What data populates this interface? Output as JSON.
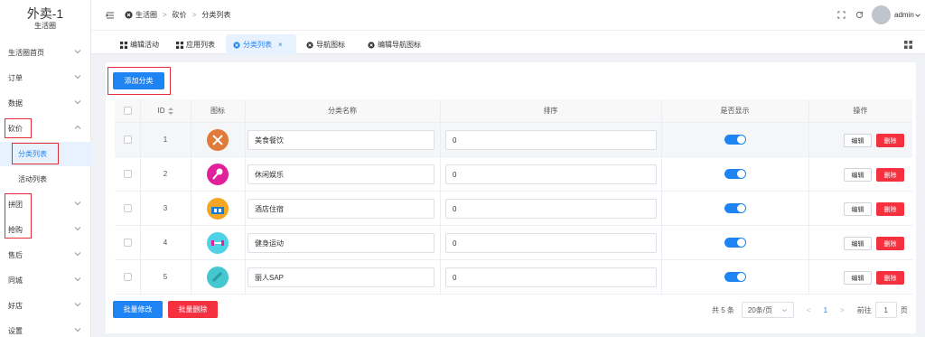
{
  "sidebar": {
    "app_title": "外卖-1",
    "app_subtitle": "生活圈",
    "items": [
      {
        "label": "生活圈首页",
        "expanded": false
      },
      {
        "label": "订单",
        "expanded": false
      },
      {
        "label": "数据",
        "expanded": false
      },
      {
        "label": "砍价",
        "expanded": true
      },
      {
        "label": "分类列表",
        "sub": true,
        "active": true
      },
      {
        "label": "活动列表",
        "sub": true
      },
      {
        "label": "拼团",
        "expanded": false
      },
      {
        "label": "抢购",
        "expanded": false
      },
      {
        "label": "售后",
        "expanded": false
      },
      {
        "label": "同城",
        "expanded": false
      },
      {
        "label": "好店",
        "expanded": false
      },
      {
        "label": "设置",
        "expanded": false
      }
    ]
  },
  "topbar": {
    "breadcrumb": [
      "生活圈",
      "砍价",
      "分类列表"
    ],
    "user": "admin"
  },
  "tabs": [
    {
      "label": "编辑活动"
    },
    {
      "label": "应用列表"
    },
    {
      "label": "分类列表",
      "active": true
    },
    {
      "label": "导航图标"
    },
    {
      "label": "编辑导航图标"
    }
  ],
  "buttons": {
    "add": "添加分类",
    "batch_edit": "批量修改",
    "batch_delete": "批量删除",
    "edit": "编辑",
    "delete": "删除"
  },
  "table": {
    "headers": [
      "ID",
      "图标",
      "分类名称",
      "排序",
      "是否显示",
      "操作"
    ],
    "rows": [
      {
        "id": "1",
        "name": "美食餐饮",
        "sort": "0",
        "icon_color": "#e07b39",
        "icon": "utensils-icon",
        "show": true
      },
      {
        "id": "2",
        "name": "休闲娱乐",
        "sort": "0",
        "icon_color": "#e0219a",
        "icon": "microphone-icon",
        "show": true
      },
      {
        "id": "3",
        "name": "酒店住宿",
        "sort": "0",
        "icon_color": "#f5a623",
        "icon": "hotel-icon",
        "show": true
      },
      {
        "id": "4",
        "name": "健身运动",
        "sort": "0",
        "icon_color": "#4fd1e6",
        "icon": "dumbbell-icon",
        "show": true
      },
      {
        "id": "5",
        "name": "丽人SAP",
        "sort": "0",
        "icon_color": "#45c7d0",
        "icon": "beauty-icon",
        "show": true
      }
    ]
  },
  "pager": {
    "total": "共 5 条",
    "page_size": "20条/页",
    "current": "1",
    "goto_label": "前往",
    "goto_value": "1",
    "page_unit": "页"
  },
  "colors": {
    "primary": "#1e84f4",
    "danger": "#f5303f",
    "highlight": "#e62e3b"
  }
}
